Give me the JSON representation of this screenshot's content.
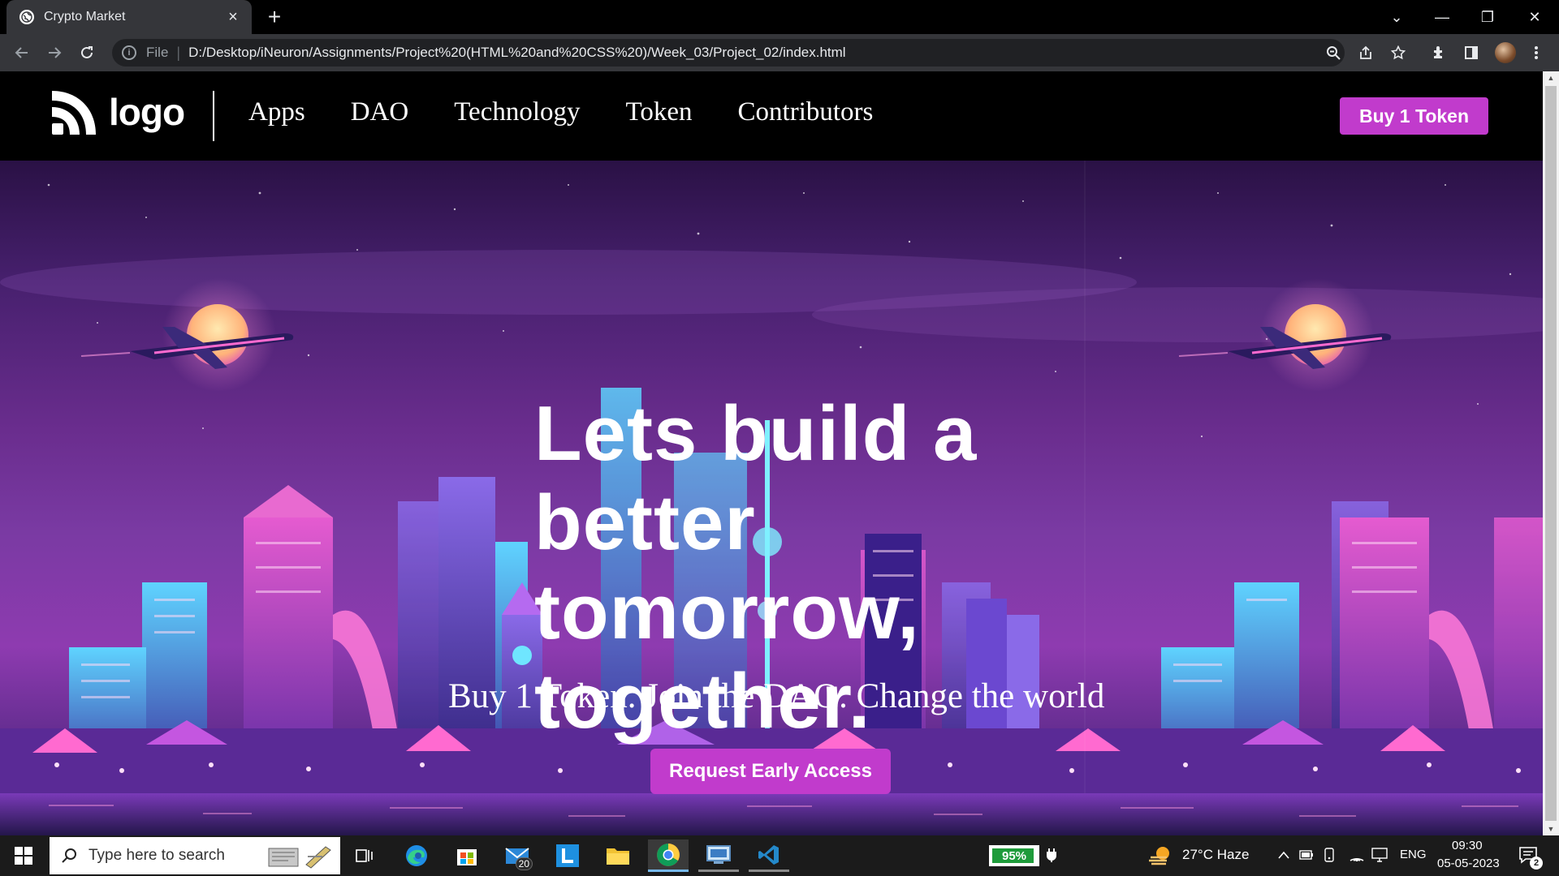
{
  "browser": {
    "tab_title": "Crypto Market",
    "new_tab_symbol": "+",
    "address_scheme": "File",
    "address_url": "D:/Desktop/iNeuron/Assignments/Project%20(HTML%20and%20CSS%20)/Week_03/Project_02/index.html",
    "window_controls": [
      "⌄",
      "—",
      "❐",
      "✕"
    ]
  },
  "site": {
    "logo_text": "logo",
    "nav_links": [
      "Apps",
      "DAO",
      "Technology",
      "Token",
      "Contributors"
    ],
    "buy_button": "Buy 1 Token",
    "hero": {
      "headline": "Lets build a better tomorrow, together.",
      "subline": "Buy 1 Token. Join the DAO. Change the world",
      "cta": "Request Early Access"
    }
  },
  "taskbar": {
    "search_placeholder": "Type here to search",
    "mail_badge": "20",
    "battery_percent": "95%",
    "battery_level": 0.95,
    "weather": "27°C  Haze",
    "language": "ENG",
    "time": "09:30",
    "date": "05-05-2023",
    "notification_count": "2"
  },
  "colors": {
    "accent": "#c13bcc",
    "nav_background": "#000000",
    "chrome_tab": "#35363a"
  }
}
